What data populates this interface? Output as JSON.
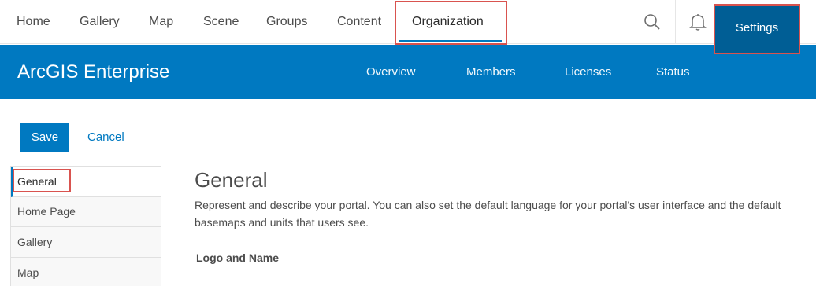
{
  "topnav": {
    "items": [
      "Home",
      "Gallery",
      "Map",
      "Scene",
      "Groups",
      "Content",
      "Organization"
    ],
    "active": "Organization",
    "icons": [
      "search-icon",
      "bell-icon",
      "apps-grid-icon"
    ]
  },
  "header": {
    "brand": "ArcGIS Enterprise",
    "tabs": [
      "Overview",
      "Members",
      "Licenses",
      "Status",
      "Settings"
    ],
    "active_tab": "Settings"
  },
  "actions": {
    "save_label": "Save",
    "cancel_label": "Cancel"
  },
  "sidebar": {
    "items": [
      "General",
      "Home Page",
      "Gallery",
      "Map"
    ],
    "active": "General"
  },
  "main": {
    "title": "General",
    "description": "Represent and describe your portal. You can also set the default language for your portal's user interface and the default basemaps and units that users see.",
    "section_title": "Logo and Name"
  },
  "colors": {
    "accent": "#0079c1",
    "accent_dark": "#005e95",
    "highlight": "#d9534f"
  }
}
